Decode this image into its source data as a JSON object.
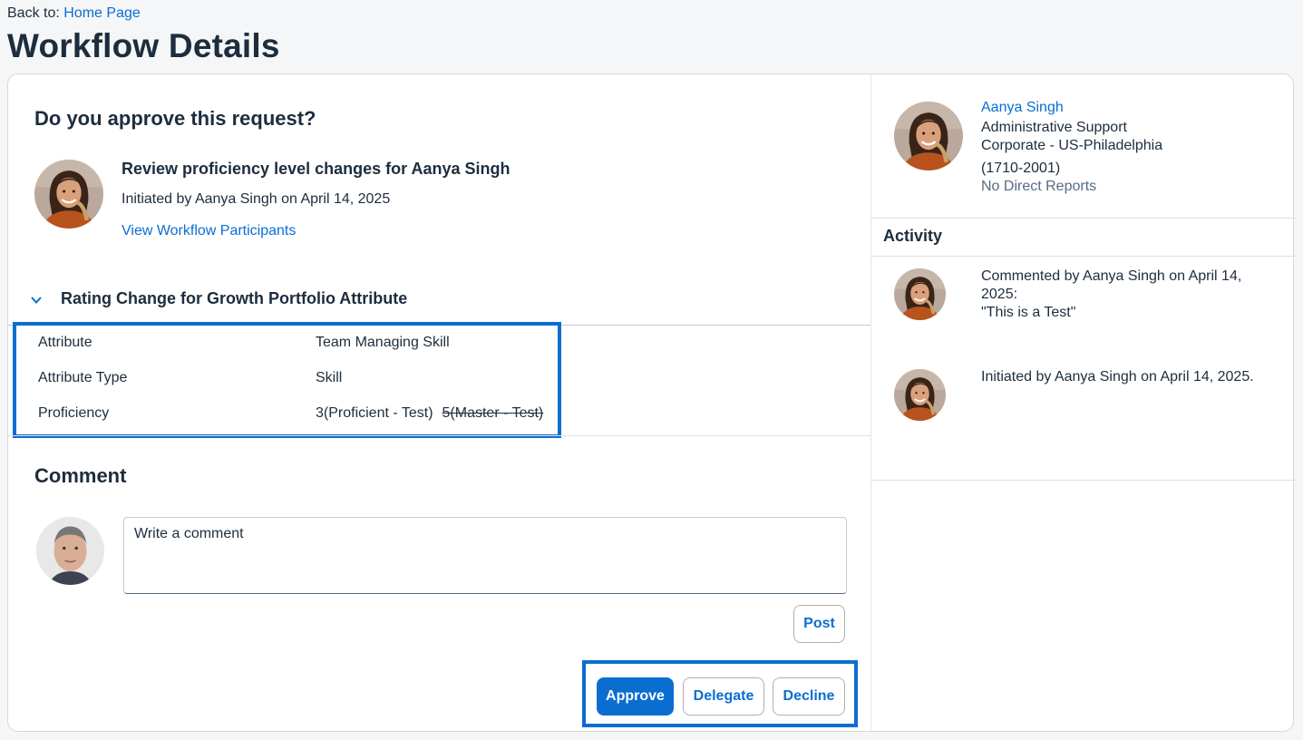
{
  "nav": {
    "back_label": "Back to:",
    "back_link": "Home Page"
  },
  "page": {
    "title": "Workflow Details"
  },
  "request": {
    "question": "Do you approve this request?",
    "title": "Review proficiency level changes for Aanya Singh",
    "initiated": "Initiated by Aanya Singh on April 14, 2025",
    "participants_link": "View Workflow Participants"
  },
  "section": {
    "title": "Rating Change for Growth Portfolio Attribute",
    "rows": [
      {
        "label": "Attribute",
        "value": "Team Managing Skill"
      },
      {
        "label": "Attribute Type",
        "value": "Skill"
      },
      {
        "label": "Proficiency",
        "value": "3(Proficient - Test)",
        "old_value": "5(Master - Test)"
      }
    ]
  },
  "comment": {
    "title": "Comment",
    "placeholder": "Write a comment",
    "post_label": "Post"
  },
  "actions": {
    "approve": "Approve",
    "delegate": "Delegate",
    "decline": "Decline"
  },
  "profile": {
    "name": "Aanya Singh",
    "role": "Administrative Support",
    "location": "Corporate - US-Philadelphia",
    "code": "(1710-2001)",
    "reports": "No Direct Reports"
  },
  "activity": {
    "title": "Activity",
    "items": [
      {
        "line1": "Commented by Aanya Singh on April 14, 2025:",
        "line2": "\"This is a Test\""
      },
      {
        "line1": "Initiated by Aanya Singh on April 14, 2025.",
        "line2": ""
      }
    ]
  },
  "colors": {
    "accent": "#0a6ed1",
    "text": "#1d2d3e",
    "muted": "#556b82",
    "background": "#f5f6f7"
  }
}
